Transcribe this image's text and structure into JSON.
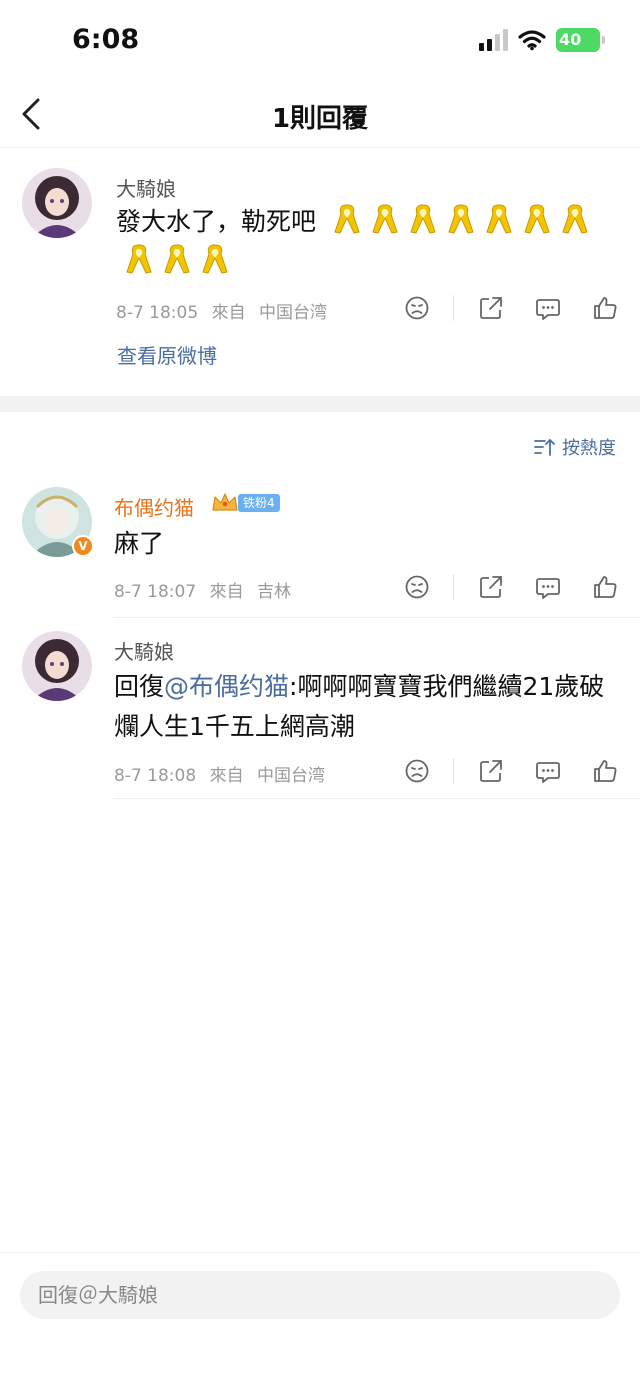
{
  "status": {
    "time": "6:08",
    "battery": "40"
  },
  "nav": {
    "title": "1則回覆"
  },
  "original": {
    "name": "大騎娘",
    "text": "發大水了，勒死吧",
    "date": "8-7 18:05",
    "from": "來自",
    "location": "中国台湾",
    "view_link": "查看原微博"
  },
  "sort": {
    "label": "按熱度"
  },
  "comments": [
    {
      "name": "布偶约猫",
      "fan_badge": "铁粉4",
      "text": "麻了",
      "date": "8-7 18:07",
      "from": "來自",
      "location": "吉林"
    },
    {
      "name": "大騎娘",
      "reply_prefix": "回復",
      "mention": "@布偶约猫",
      "text": ":啊啊啊寶寶我們繼續21歲破爛人生1千五上網高潮",
      "date": "8-7 18:08",
      "from": "來自",
      "location": "中国台湾"
    }
  ],
  "reply": {
    "placeholder": "回復＠大騎娘"
  },
  "colors": {
    "accent": "#4a6ea0",
    "vip_name": "#e8741d",
    "ribbon": "#f2c400"
  },
  "icons": [
    "back-icon",
    "signal-icon",
    "wifi-icon",
    "battery-icon",
    "dislike-icon",
    "share-icon",
    "comment-icon",
    "like-icon",
    "sort-icon",
    "ribbon-icon",
    "crown-icon"
  ]
}
